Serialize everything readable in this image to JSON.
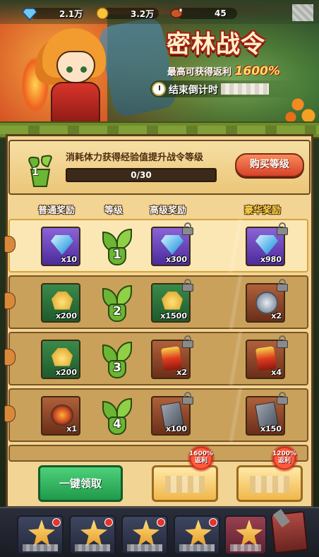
{
  "resources": [
    {
      "icon": "diamond-icon",
      "value": "2.1万"
    },
    {
      "icon": "gold-coin-icon",
      "value": "3.2万"
    },
    {
      "icon": "meat-stamina-icon",
      "value": "45"
    }
  ],
  "banner": {
    "title": "密林战令",
    "subtitle_prefix": "最高可获得返利",
    "subtitle_pct": "1600%",
    "countdown_label": "结束倒计时"
  },
  "level": {
    "current": "1",
    "description": "消耗体力获得经验值提升战令等级",
    "progress_text": "0/30",
    "progress_fraction": 0,
    "buy_button": "购买等级"
  },
  "columns": {
    "normal": "普通奖励",
    "level": "等级",
    "advanced": "高级奖励",
    "luxury": "豪华奖励"
  },
  "rows": [
    {
      "level": "1",
      "normal": {
        "item": "diamond",
        "qty": "x10"
      },
      "advanced": {
        "item": "diamond",
        "qty": "x300",
        "locked": true
      },
      "luxury": {
        "item": "diamond",
        "qty": "x980",
        "locked": true
      },
      "active": true
    },
    {
      "level": "2",
      "normal": {
        "item": "gold-ore",
        "qty": "x200"
      },
      "advanced": {
        "item": "gold-ore",
        "qty": "x1500",
        "locked": true
      },
      "luxury": {
        "item": "silver-medal",
        "qty": "x2",
        "locked": true
      },
      "active": false
    },
    {
      "level": "3",
      "normal": {
        "item": "gold-ore",
        "qty": "x200"
      },
      "advanced": {
        "item": "red-scroll",
        "qty": "x2",
        "locked": true
      },
      "luxury": {
        "item": "red-scroll",
        "qty": "x4",
        "locked": true
      },
      "active": false
    },
    {
      "level": "4",
      "normal": {
        "item": "fire-bomb",
        "qty": "x1"
      },
      "advanced": {
        "item": "stone-tablet",
        "qty": "x100",
        "locked": true
      },
      "luxury": {
        "item": "stone-tablet",
        "qty": "x150",
        "locked": true
      },
      "active": false
    }
  ],
  "actions": {
    "claim_all": "一键领取",
    "ribbon_advanced": [
      "1600%",
      "返利"
    ],
    "ribbon_luxury": [
      "1200%",
      "返利"
    ]
  }
}
